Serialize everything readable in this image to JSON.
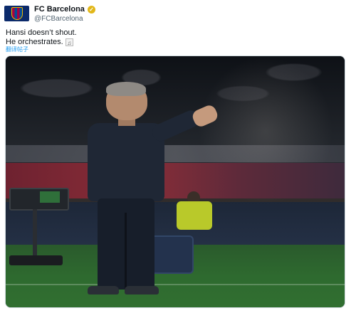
{
  "tweet": {
    "author": {
      "display_name": "FC Barcelona",
      "handle": "@FCBarcelona",
      "verified_badge_icon": "verified-badge-icon",
      "verified_badge_color": "#e2b719"
    },
    "text_lines": [
      "Hansi doesn’t shout.",
      "He orchestrates."
    ],
    "emoji_icon": "musical-score-icon",
    "translate_label": "翻译帖子",
    "accent_color": "#1d9bf0"
  }
}
